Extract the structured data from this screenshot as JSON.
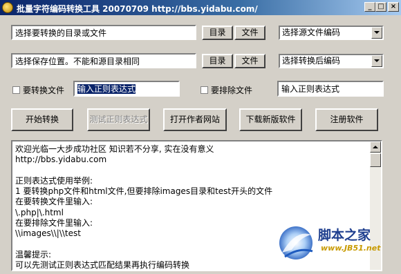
{
  "window": {
    "title": "批量字符编码转换工具 20070709 http://bbs.yidabu.com/",
    "title_buttons": {
      "minimize": "_",
      "maximize": "□",
      "close": "×"
    }
  },
  "source": {
    "path_value": "选择要转换的目录或文件",
    "dir_button": "目录",
    "file_button": "文件",
    "encoding_select": "选择源文件编码"
  },
  "target": {
    "path_value": "选择保存位置。不能和源目录相同",
    "dir_button": "目录",
    "file_button": "文件",
    "encoding_select": "选择转换后编码"
  },
  "filters": {
    "include_label": "要转换文件",
    "include_value": "输入正则表达式",
    "exclude_label": "要排除文件",
    "exclude_value": "输入正则表达式"
  },
  "actions": {
    "start": "开始转换",
    "test_regex": "测试正则表达式",
    "open_site": "打开作者网站",
    "download": "下载新版软件",
    "register": "注册软件"
  },
  "log": {
    "lines": [
      "欢迎光临一大步成功社区 知识若不分享, 实在没有意义",
      "http://bbs.yidabu.com",
      "",
      "正则表达式使用举例:",
      "1 要转换php文件和html文件,但要排除images目录和test开头的文件",
      "在要转换文件里输入:",
      "\\.php|\\.html",
      "在要排除文件里输入:",
      "\\\\images\\\\|\\\\test",
      "",
      "温馨提示:",
      "可以先测试正则表达式匹配结果再执行编码转换"
    ]
  },
  "watermark": {
    "text": "脚本之家",
    "url": "www.JB51.net"
  }
}
